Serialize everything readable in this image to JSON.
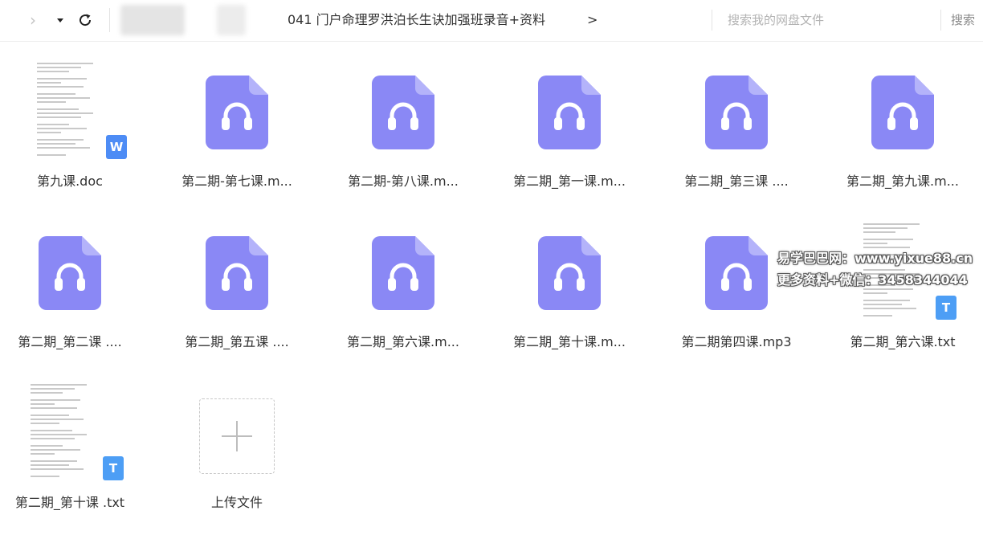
{
  "toolbar": {
    "forward_glyph": "›",
    "breadcrumb_current": "041 门户命理罗洪泊长生诀加强班录音+资料",
    "breadcrumb_chevron": ">",
    "search_placeholder": "搜索我的网盘文件",
    "search_button": "搜索"
  },
  "files": [
    {
      "name": "第九课.doc",
      "kind": "doc"
    },
    {
      "name": "第二期-第七课.m...",
      "kind": "audio"
    },
    {
      "name": "第二期-第八课.m...",
      "kind": "audio"
    },
    {
      "name": "第二期_第一课.m...",
      "kind": "audio"
    },
    {
      "name": "第二期_第三课 ....",
      "kind": "audio"
    },
    {
      "name": "第二期_第九课.m...",
      "kind": "audio"
    },
    {
      "name": "第二期_第二课 ....",
      "kind": "audio"
    },
    {
      "name": "第二期_第五课 ....",
      "kind": "audio"
    },
    {
      "name": "第二期_第六课.m...",
      "kind": "audio"
    },
    {
      "name": "第二期_第十课.m...",
      "kind": "audio"
    },
    {
      "name": "第二期第四课.mp3",
      "kind": "audio"
    },
    {
      "name": "第二期_第六课.txt",
      "kind": "txt"
    },
    {
      "name": "第二期_第十课 .txt",
      "kind": "txt"
    }
  ],
  "upload": {
    "label": "上传文件",
    "icon": "plus-icon"
  },
  "badges": {
    "doc": "W",
    "txt": "T"
  },
  "watermark": {
    "line1": "易学巴巴网：www.yixue88.cn",
    "line2": "更多资料+微信：3458344044"
  },
  "colors": {
    "audio_icon": "#8a88f5",
    "doc_badge": "#4d8cf5",
    "txt_badge": "#4d9ef5",
    "text": "#333333"
  }
}
